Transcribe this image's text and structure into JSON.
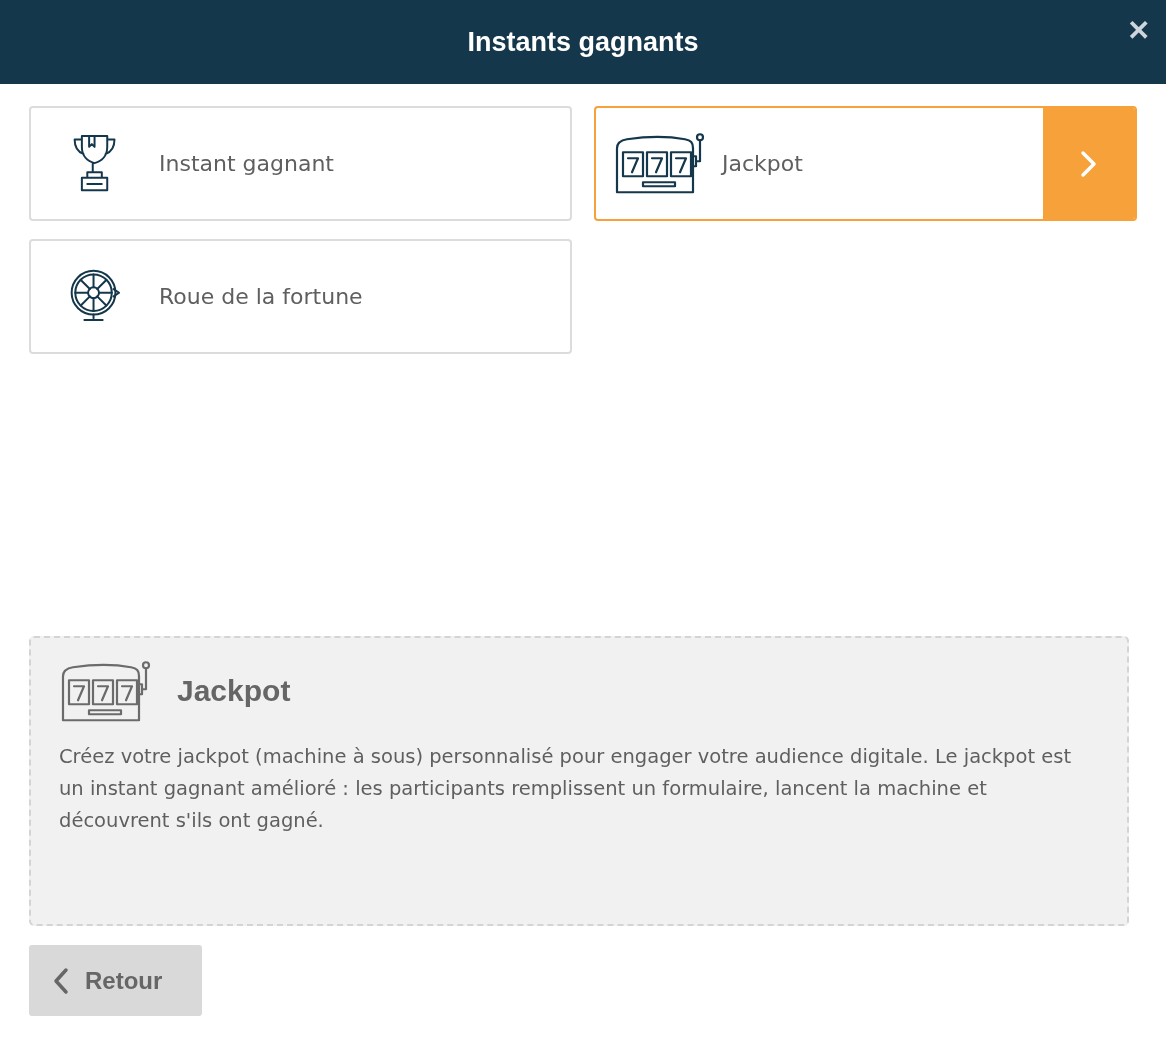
{
  "header": {
    "title": "Instants gagnants",
    "close": "✕"
  },
  "games": [
    {
      "label": "Instant gagnant",
      "kind": "trophy",
      "selected": false
    },
    {
      "label": "Jackpot",
      "kind": "slot",
      "selected": true
    },
    {
      "label": "Roue de la fortune",
      "kind": "wheel",
      "selected": false
    }
  ],
  "description": {
    "kind": "slot",
    "title": "Jackpot",
    "text": "Créez votre jackpot (machine à sous) personnalisé pour engager votre audience digitale. Le jackpot est un instant gagnant amélioré : les participants remplissent un formulaire, lancent la machine et découvrent s'ils ont gagné."
  },
  "back_button": {
    "label": "Retour"
  }
}
